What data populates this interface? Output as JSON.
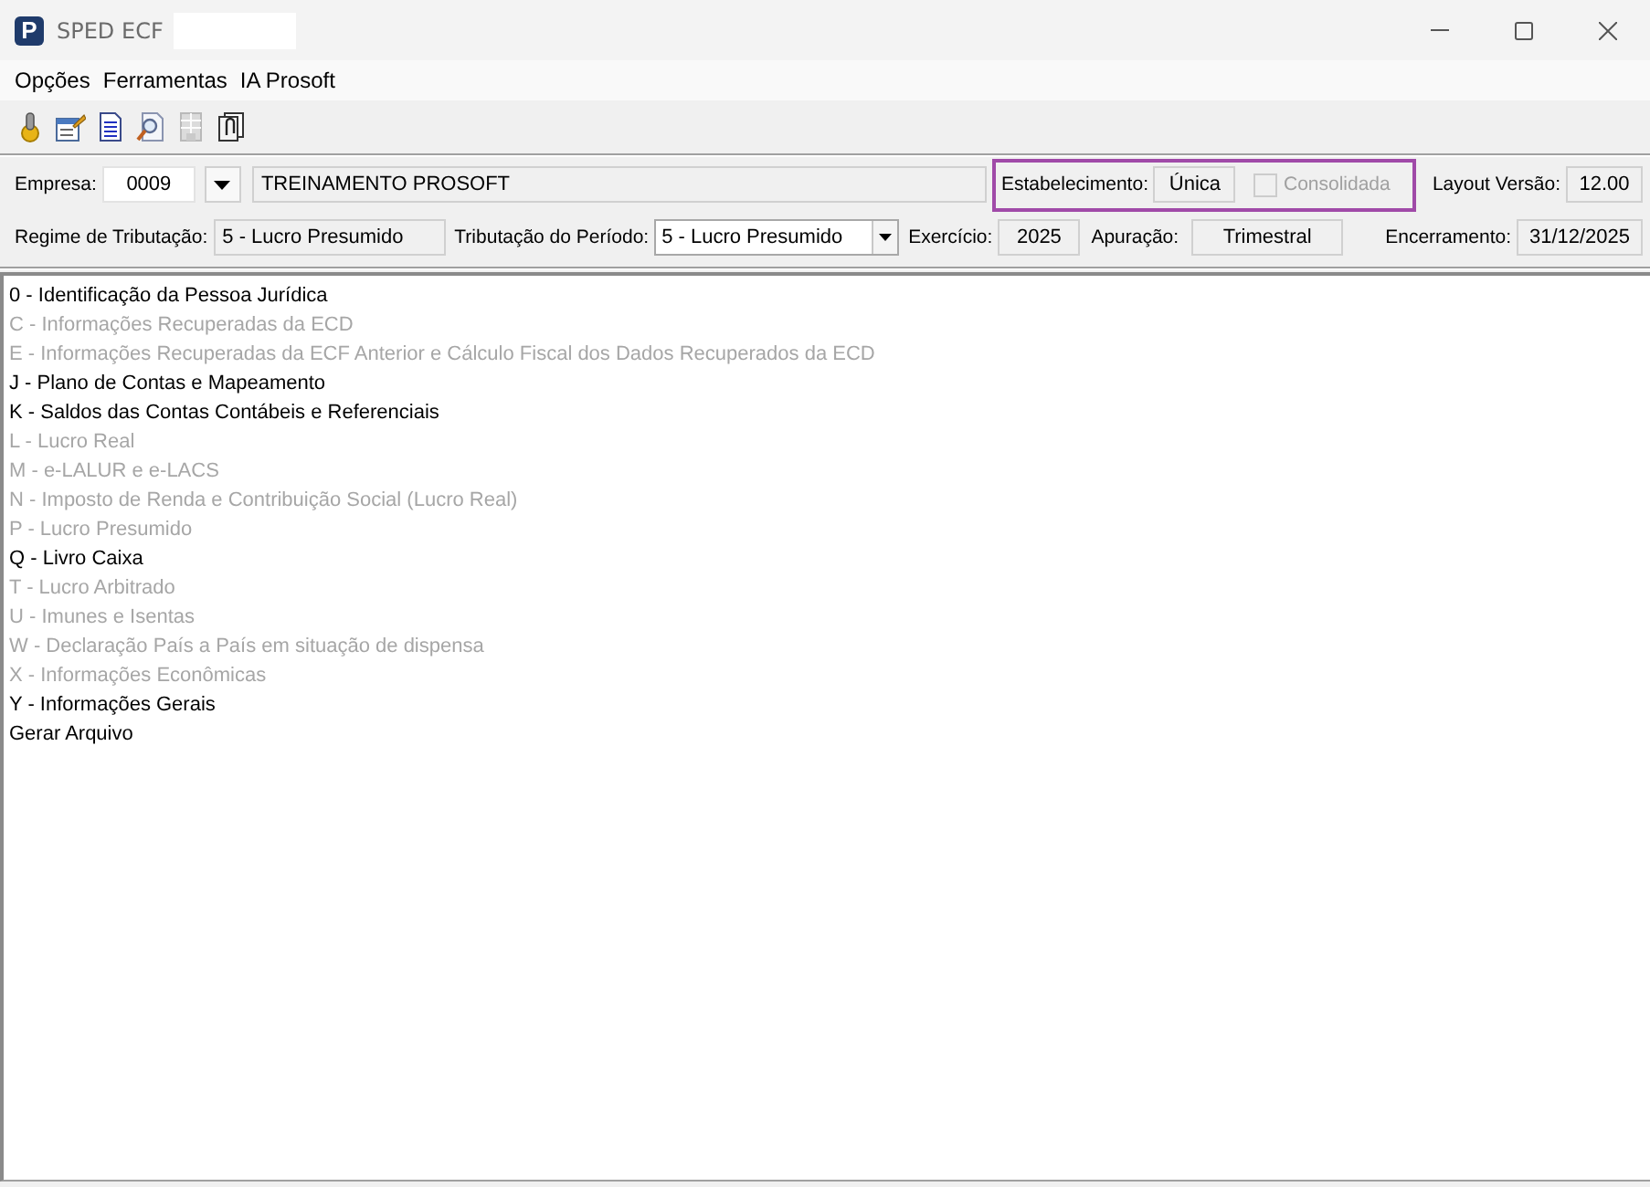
{
  "window": {
    "logo_letter": "P",
    "title": "SPED ECF"
  },
  "menu": [
    "Opções",
    "Ferramentas",
    "IA Prosoft"
  ],
  "toolbar": [
    {
      "disabled": false
    },
    {
      "disabled": false
    },
    {
      "disabled": false
    },
    {
      "disabled": false
    },
    {
      "disabled": true
    },
    {
      "disabled": false
    }
  ],
  "header": {
    "empresa": {
      "label": "Empresa:",
      "code": "0009",
      "name": "TREINAMENTO PROSOFT"
    },
    "estabelecimento": {
      "label": "Estabelecimento:",
      "value": "Única",
      "highlighted": true
    },
    "consolidada": {
      "label": "Consolidada",
      "checked": false,
      "disabled": true
    },
    "layout_versao": {
      "label": "Layout Versão:",
      "value": "12.00"
    },
    "regime": {
      "label": "Regime de Tributação:",
      "value": "5 - Lucro Presumido"
    },
    "tributacao_periodo": {
      "label": "Tributação do Período:",
      "value": "5 - Lucro Presumido"
    },
    "exercicio": {
      "label": "Exercício:",
      "value": "2025"
    },
    "apuracao": {
      "label": "Apuração:",
      "value": "Trimestral"
    },
    "encerramento": {
      "label": "Encerramento:",
      "value": "31/12/2025"
    }
  },
  "blocks": [
    {
      "label": "0 - Identificação da Pessoa Jurídica",
      "disabled": false
    },
    {
      "label": "C - Informações Recuperadas da ECD",
      "disabled": true
    },
    {
      "label": "E - Informações Recuperadas da ECF Anterior e Cálculo Fiscal dos Dados Recuperados da ECD",
      "disabled": true
    },
    {
      "label": "J - Plano de Contas e Mapeamento",
      "disabled": false
    },
    {
      "label": "K - Saldos das Contas Contábeis e Referenciais",
      "disabled": false
    },
    {
      "label": "L - Lucro Real",
      "disabled": true
    },
    {
      "label": "M - e-LALUR e e-LACS",
      "disabled": true
    },
    {
      "label": "N - Imposto de Renda e Contribuição Social (Lucro Real)",
      "disabled": true
    },
    {
      "label": "P - Lucro Presumido",
      "disabled": true
    },
    {
      "label": "Q - Livro Caixa",
      "disabled": false
    },
    {
      "label": "T - Lucro Arbitrado",
      "disabled": true
    },
    {
      "label": "U - Imunes e Isentas",
      "disabled": true
    },
    {
      "label": "W - Declaração País a País em situação de dispensa",
      "disabled": true
    },
    {
      "label": "X - Informações Econômicas",
      "disabled": true
    },
    {
      "label": "Y - Informações Gerais",
      "disabled": false
    },
    {
      "label": "Gerar Arquivo",
      "disabled": false
    }
  ]
}
